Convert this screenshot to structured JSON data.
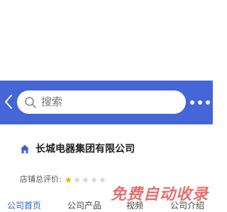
{
  "search": {
    "placeholder": "搜索"
  },
  "company": {
    "name": "长城电器集团有限公司"
  },
  "rating": {
    "label": "店铺总评价:",
    "stars_filled": 1,
    "stars_total": 5
  },
  "nav": {
    "items": [
      {
        "label": "公司首页"
      },
      {
        "label": "公司产品"
      },
      {
        "label": "视频"
      },
      {
        "label": "公司介绍"
      }
    ]
  },
  "watermark": {
    "text": "免费自动收录"
  },
  "colors": {
    "accent": "#4566d6",
    "active_nav": "#2b62d9",
    "star_filled": "#f5b400",
    "star_empty": "#d8d8d8"
  },
  "icons": {
    "back": "chevron-left-icon",
    "search": "search-icon",
    "more": "more-dots-icon",
    "home": "home-icon",
    "star": "star-icon"
  }
}
